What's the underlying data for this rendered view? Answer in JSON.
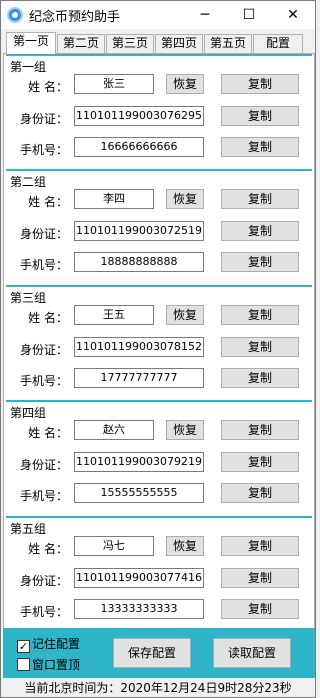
{
  "window": {
    "title": "纪念币预约助手",
    "minimize": "─",
    "maximize": "☐",
    "close": "✕"
  },
  "tabs": [
    {
      "label": "第一页",
      "active": true
    },
    {
      "label": "第二页"
    },
    {
      "label": "第三页"
    },
    {
      "label": "第四页"
    },
    {
      "label": "第五页"
    },
    {
      "label": "配置"
    }
  ],
  "labels": {
    "name": "姓  名：",
    "id": "身份证：",
    "phone": "手机号：",
    "restore": "恢复",
    "copy": "复制"
  },
  "groups": [
    {
      "title": "第一组",
      "name": "张三",
      "id": "110101199003076295",
      "phone": "16666666666"
    },
    {
      "title": "第二组",
      "name": "李四",
      "id": "110101199003072519",
      "phone": "18888888888"
    },
    {
      "title": "第三组",
      "name": "王五",
      "id": "110101199003078152",
      "phone": "17777777777"
    },
    {
      "title": "第四组",
      "name": "赵六",
      "id": "110101199003079219",
      "phone": "15555555555"
    },
    {
      "title": "第五组",
      "name": "冯七",
      "id": "110101199003077416",
      "phone": "13333333333"
    }
  ],
  "footer": {
    "remember_config": "记住配置",
    "remember_checked": true,
    "window_top": "窗口置顶",
    "window_top_checked": false,
    "save_button": "保存配置",
    "load_button": "读取配置"
  },
  "status": "当前北京时间为：2020年12月24日9时28分23秒",
  "colors": {
    "accent": "#2fb5c8"
  }
}
